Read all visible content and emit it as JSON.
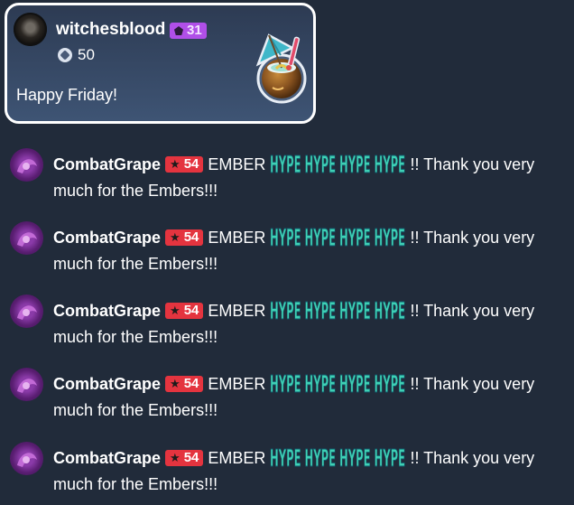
{
  "ember_card": {
    "username": "witchesblood",
    "level": "31",
    "ember_amount": "50",
    "message": "Happy Friday!",
    "sticker": "coconut-drink-sticker",
    "level_badge_color": "#b04fe8",
    "border_color": "#ffffff"
  },
  "messages": [
    {
      "user": "CombatGrape",
      "level": "54",
      "pre": "EMBER",
      "emote_text": "HYPE HYPE HYPE HYPE",
      "post": "!! Thank you very much for the Embers!!!"
    },
    {
      "user": "CombatGrape",
      "level": "54",
      "pre": "EMBER",
      "emote_text": "HYPE HYPE HYPE HYPE",
      "post": "!! Thank you very much for the Embers!!!"
    },
    {
      "user": "CombatGrape",
      "level": "54",
      "pre": "EMBER",
      "emote_text": "HYPE HYPE HYPE HYPE",
      "post": "!! Thank you very much for the Embers!!!"
    },
    {
      "user": "CombatGrape",
      "level": "54",
      "pre": "EMBER",
      "emote_text": "HYPE HYPE HYPE HYPE",
      "post": "!! Thank you very much for the Embers!!!"
    },
    {
      "user": "CombatGrape",
      "level": "54",
      "pre": "EMBER",
      "emote_text": "HYPE HYPE HYPE HYPE",
      "post": "!! Thank you very much for the Embers!!!"
    }
  ],
  "colors": {
    "background": "#212b3a",
    "level_badge_red": "#e4343f",
    "hype_emote": "#3fd0b4"
  }
}
